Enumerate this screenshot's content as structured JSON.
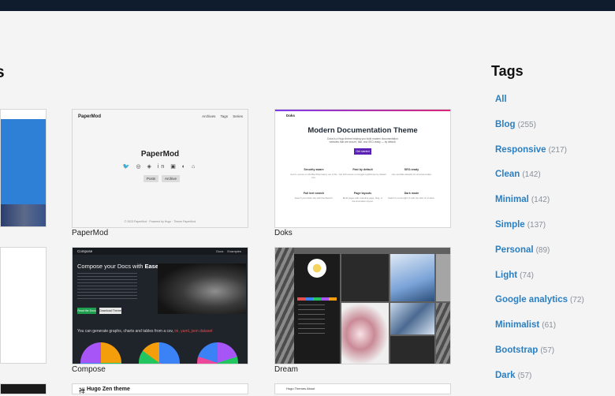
{
  "page": {
    "heading_left": "s",
    "tags_title": "Tags"
  },
  "tags": [
    {
      "name": "All",
      "count": ""
    },
    {
      "name": "Blog",
      "count": "(255)"
    },
    {
      "name": "Responsive",
      "count": "(217)"
    },
    {
      "name": "Clean",
      "count": "(142)"
    },
    {
      "name": "Minimal",
      "count": "(142)"
    },
    {
      "name": "Simple",
      "count": "(137)"
    },
    {
      "name": "Personal",
      "count": "(89)"
    },
    {
      "name": "Light",
      "count": "(74)"
    },
    {
      "name": "Google analytics",
      "count": "(72)"
    },
    {
      "name": "Minimalist",
      "count": "(61)"
    },
    {
      "name": "Bootstrap",
      "count": "(57)"
    },
    {
      "name": "Dark",
      "count": "(57)"
    }
  ],
  "themes": {
    "papermod": {
      "caption": "PaperMod",
      "logo": "PaperMod",
      "nav": "Archives Tags Series",
      "title": "PaperMod",
      "icons": "🐦 ◎ ◈ in ▣ ◐ ⌂",
      "buttons": [
        "Posts",
        "Archive"
      ],
      "footer": "© 2023 PaperMod · Powered by Hugo · Theme PaperMod"
    },
    "doks": {
      "caption": "Doks",
      "logo": "Doks",
      "headline": "Modern Documentation Theme",
      "subtitle": "Doks is a Hugo theme helping you build modern documentation websites that are secure, fast, and SEO-ready — by default.",
      "button": "Get started",
      "features": [
        {
          "title": "Security aware",
          "text": "Get A+ scores on Mozilla Observatory out of the box."
        },
        {
          "title": "Fast by default",
          "text": "Get 100 scores on Google Lighthouse by default."
        },
        {
          "title": "SEO-ready",
          "text": "Use sensible defaults for structured data."
        },
        {
          "title": "Full text search",
          "text": "Search your Doks site with FlexSearch."
        },
        {
          "title": "Page layouts",
          "text": "Build pages with a landing page, blog, or documentation layout."
        },
        {
          "title": "Dark mode",
          "text": "Switch to a low-light UI with the click of a button."
        }
      ]
    },
    "compose": {
      "caption": "Compose",
      "logo": "Compose",
      "nav": "Docs Examples",
      "title_start": "Compose your Docs with ",
      "title_bold": "Ease.",
      "button_primary": "Read the Docs",
      "button_secondary": "Download Theme",
      "subheading_start": "You can generate graphs, charts and tables from a csv, ",
      "subheading_accent": "ini, yaml, json dataset"
    },
    "dream": {
      "caption": "Dream"
    },
    "hugo_zen": {
      "icon": "禅",
      "title": "Hugo Zen theme"
    },
    "bottom3": {
      "logo": "Hugo Themes  About"
    }
  },
  "colors": {
    "tag_link": "#2a7fc1",
    "tag_count": "#8a8f98",
    "topbar": "#0f1c2e",
    "background": "#f4f4f5"
  }
}
